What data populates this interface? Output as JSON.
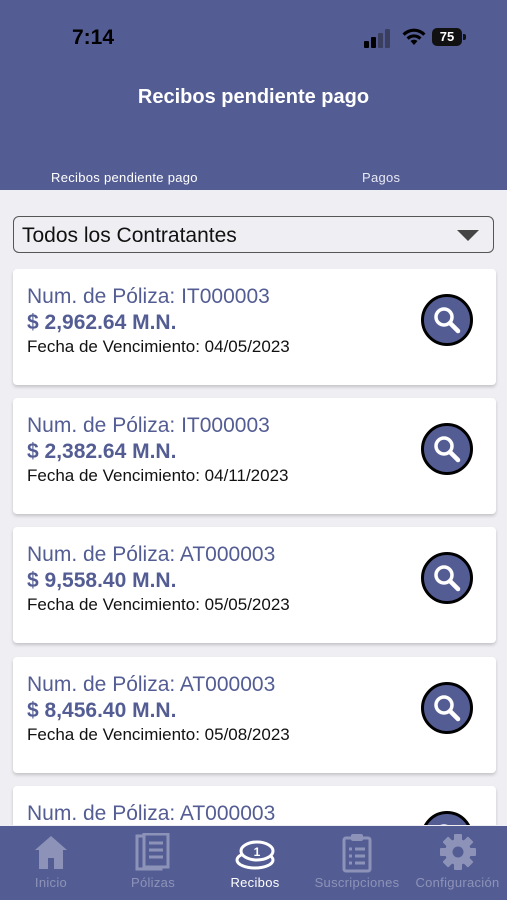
{
  "status_bar": {
    "time": "7:14",
    "battery": "75"
  },
  "header": {
    "title": "Recibos pendiente pago",
    "tabs": [
      {
        "label": "Recibos pendiente pago",
        "selected": true
      },
      {
        "label": "Pagos",
        "selected": false
      }
    ]
  },
  "filter": {
    "selected": "Todos los Contratantes"
  },
  "receipts": [
    {
      "policy": "Num. de Póliza: IT000003",
      "amount": "$ 2,962.64 M.N.",
      "due": "Fecha de Vencimiento: 04/05/2023"
    },
    {
      "policy": "Num. de Póliza: IT000003",
      "amount": "$ 2,382.64 M.N.",
      "due": "Fecha de Vencimiento: 04/11/2023"
    },
    {
      "policy": "Num. de Póliza: AT000003",
      "amount": "$ 9,558.40 M.N.",
      "due": "Fecha de Vencimiento: 05/05/2023"
    },
    {
      "policy": "Num. de Póliza: AT000003",
      "amount": "$ 8,456.40 M.N.",
      "due": "Fecha de Vencimiento: 05/08/2023"
    },
    {
      "policy": "Num. de Póliza: AT000003",
      "amount": "",
      "due": ""
    }
  ],
  "tabbar": {
    "items": [
      {
        "label": "Inicio",
        "icon": "home-icon",
        "active": false
      },
      {
        "label": "Pólizas",
        "icon": "policies-icon",
        "active": false
      },
      {
        "label": "Recibos",
        "icon": "receipts-icon",
        "active": true
      },
      {
        "label": "Suscripciones",
        "icon": "clipboard-icon",
        "active": false
      },
      {
        "label": "Configuración",
        "icon": "gear-icon",
        "active": false
      }
    ]
  },
  "colors": {
    "brand": "#545d93",
    "background": "#eeeef3",
    "inactive_tab": "#8d93b8"
  }
}
